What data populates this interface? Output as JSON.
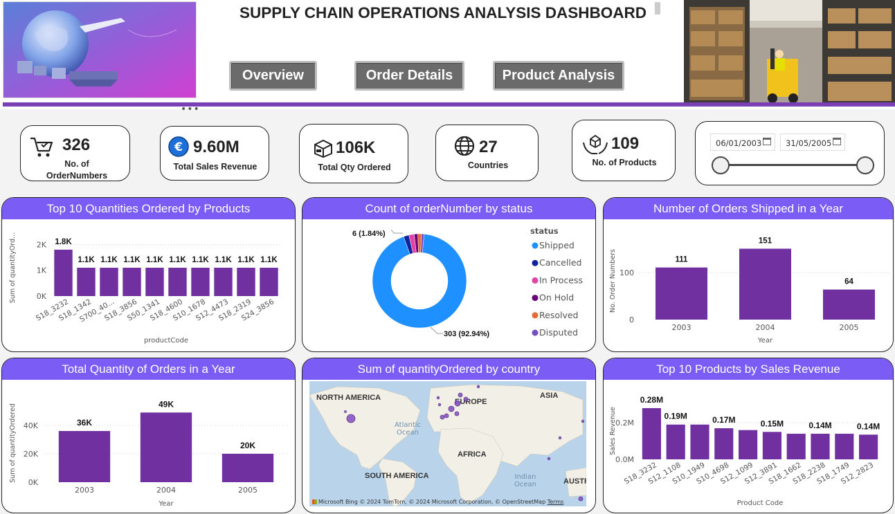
{
  "header": {
    "title": "SUPPLY CHAIN OPERATIONS ANALYSIS DASHBOARD",
    "nav": [
      "Overview",
      "Order Details",
      "Product Analysis"
    ],
    "more": "•••"
  },
  "kpis": {
    "orders": {
      "value": "326",
      "label_line1": "No. of",
      "label_line2": "OrderNumbers",
      "icon": "cart-icon"
    },
    "revenue": {
      "value": "9.60M",
      "label": "Total Sales Revenue",
      "icon": "euro-icon"
    },
    "qty": {
      "value": "106K",
      "label": "Total Qty Ordered",
      "icon": "box-icon"
    },
    "countries": {
      "value": "27",
      "label": "Countries",
      "icon": "globe-icon"
    },
    "products": {
      "value": "109",
      "label": "No. of Products",
      "icon": "hands-box-icon"
    }
  },
  "date_filter": {
    "start": "06/01/2003",
    "end": "31/05/2005",
    "range_start_frac": 0,
    "range_end_frac": 1
  },
  "colors": {
    "accent": "#7a3fb5",
    "panel_header": "#7b5cf5",
    "bar": "#7030a0",
    "shipped": "#1e90ff"
  },
  "chart_data": [
    {
      "id": "top_qty_products",
      "type": "bar",
      "title": "Top 10 Quantities Ordered by Products",
      "categories": [
        "S18_3232",
        "S18_1342",
        "S700_40...",
        "S18_3856",
        "S50_1341",
        "S18_4600",
        "S10_1678",
        "S12_4473",
        "S18_2319",
        "S24_3856"
      ],
      "values": [
        1800,
        1100,
        1100,
        1100,
        1100,
        1100,
        1100,
        1100,
        1100,
        1100
      ],
      "data_labels": [
        "1.8K",
        "1.1K",
        "1.1K",
        "1.1K",
        "1.1K",
        "1.1K",
        "1.1K",
        "1.1K",
        "1.1K",
        "1.1K"
      ],
      "xlabel": "productCode",
      "ylabel": "Sum of quantityOrd...",
      "yticks": [
        "0K",
        "1K",
        "2K"
      ],
      "ylim": [
        0,
        2200
      ]
    },
    {
      "id": "status_donut",
      "type": "pie",
      "title": "Count of orderNumber by status",
      "legend_title": "status",
      "categories": [
        "Shipped",
        "Cancelled",
        "In Process",
        "On Hold",
        "Resolved",
        "Disputed"
      ],
      "values": [
        303,
        6,
        6,
        4,
        4,
        3
      ],
      "colors": [
        "#1e90ff",
        "#12239e",
        "#e044a7",
        "#6b007b",
        "#e66c37",
        "#744ec2"
      ],
      "data_labels": [
        "303 (92.94%)",
        "6 (1.84%)"
      ],
      "legend_placement": "right"
    },
    {
      "id": "orders_shipped_year",
      "type": "bar",
      "title": "Number of Orders Shipped in a Year",
      "categories": [
        "2003",
        "2004",
        "2005"
      ],
      "values": [
        111,
        151,
        64
      ],
      "data_labels": [
        "111",
        "151",
        "64"
      ],
      "xlabel": "Year",
      "ylabel": "No. Order Numbers",
      "yticks": [
        "0",
        "100"
      ],
      "ylim": [
        0,
        165
      ]
    },
    {
      "id": "total_qty_year",
      "type": "bar",
      "title": "Total Quantity of Orders in a Year",
      "categories": [
        "2003",
        "2004",
        "2005"
      ],
      "values": [
        36000,
        49000,
        20000
      ],
      "data_labels": [
        "36K",
        "49K",
        "20K"
      ],
      "xlabel": "Year",
      "ylabel": "Sum of quantityOrdered",
      "yticks": [
        "0K",
        "20K",
        "40K"
      ],
      "ylim": [
        0,
        55000
      ]
    },
    {
      "id": "top_products_revenue",
      "type": "bar",
      "title": "Top 10 Products by Sales Revenue",
      "categories": [
        "S18_3232",
        "S12_1108",
        "S10_1949",
        "S10_4698",
        "S12_1099",
        "S12_3891",
        "S18_1662",
        "S18_2238",
        "S18_1749",
        "S12_2823"
      ],
      "values": [
        0.28,
        0.19,
        0.19,
        0.17,
        0.16,
        0.15,
        0.14,
        0.14,
        0.14,
        0.135
      ],
      "data_labels": [
        "0.28M",
        "0.19M",
        "",
        "0.17M",
        "",
        "0.15M",
        "",
        "0.14M",
        "",
        "0.14M"
      ],
      "xlabel": "Product Code",
      "ylabel": "Sales Revenue",
      "yticks": [
        "0.0M",
        "0.2M"
      ],
      "ylim": [
        0,
        0.31
      ]
    }
  ],
  "map": {
    "title": "Sum of quantityOrdered by country",
    "labels": [
      "NORTH AMERICA",
      "EUROPE",
      "ASIA",
      "AFRICA",
      "SOUTH AMERICA",
      "AUSTR"
    ],
    "oceans": [
      "Atlantic Ocean",
      "Indian Ocean"
    ],
    "attribution": "© 2024 TomTom, © 2024 Microsoft Corporation, © OpenStreetMap",
    "terms": "Terms",
    "brand": "Microsoft Bing"
  }
}
